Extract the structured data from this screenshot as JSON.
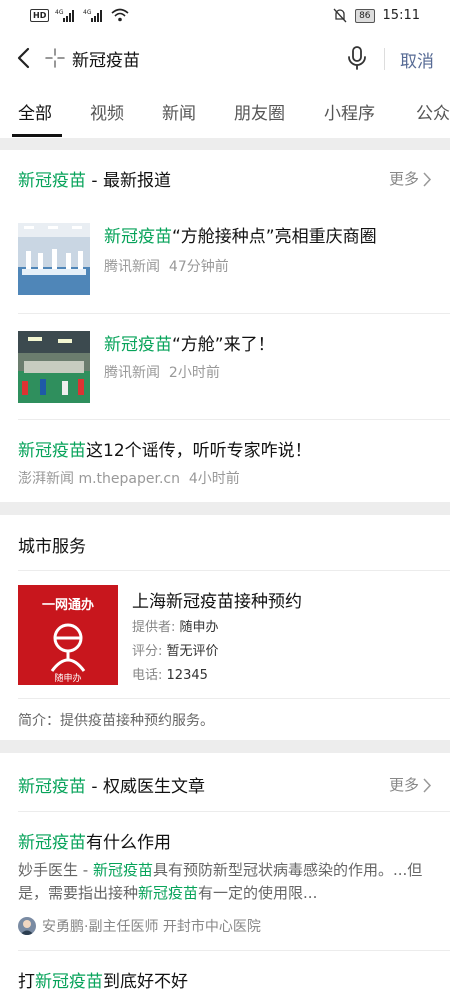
{
  "status_bar": {
    "network_badge": "HD",
    "signal_1": "4G",
    "signal_2": "4G",
    "battery": "86",
    "time": "15:11"
  },
  "search": {
    "query": "新冠疫苗",
    "cancel_label": "取消"
  },
  "tabs": [
    "全部",
    "视频",
    "新闻",
    "朋友圈",
    "小程序",
    "公众"
  ],
  "news_section": {
    "title_keyword": "新冠疫苗",
    "title_rest": " - 最新报道",
    "more_label": "更多",
    "items": [
      {
        "keyword": "新冠疫苗",
        "rest": "“方舱接种点”亮相重庆商圈",
        "source": "腾讯新闻",
        "time": "47分钟前"
      },
      {
        "keyword": "新冠疫苗",
        "rest": "“方舱”来了！",
        "source": "腾讯新闻",
        "time": "2小时前"
      }
    ],
    "text_item": {
      "keyword": "新冠疫苗",
      "rest": "这12个谣传，听听专家咋说！",
      "source": "澎湃新闻 m.thepaper.cn",
      "time": "4小时前"
    }
  },
  "city_service": {
    "section_title": "城市服务",
    "logo_text_top": "一网通办",
    "logo_text_bottom": "随申办",
    "name": "上海新冠疫苗接种预约",
    "provider_label": "提供者:",
    "provider": "随申办",
    "rating_label": "评分:",
    "rating": "暂无评价",
    "phone_label": "电话:",
    "phone": "12345",
    "intro": "简介：提供疫苗接种预约服务。"
  },
  "articles_section": {
    "title_keyword": "新冠疫苗",
    "title_rest": " - 权威医生文章",
    "more_label": "更多",
    "article1": {
      "keyword": "新冠疫苗",
      "rest": "有什么作用",
      "snippet_a": "妙手医生 - ",
      "snippet_kw1": "新冠疫苗",
      "snippet_b": "具有预防新型冠状病毒感染的作",
      "snippet_c": "用。...但是，需要指出接种",
      "snippet_kw2": "新冠疫苗",
      "snippet_d": "有一定的使用限...",
      "author": "安勇鹏·副主任医师 开封市中心医院"
    },
    "article2": {
      "prefix": "打",
      "keyword": "新冠疫苗",
      "rest": "到底好不好"
    }
  },
  "colors": {
    "highlight": "#07a35a",
    "link_blue": "#576b95",
    "logo_red": "#c8161d"
  }
}
